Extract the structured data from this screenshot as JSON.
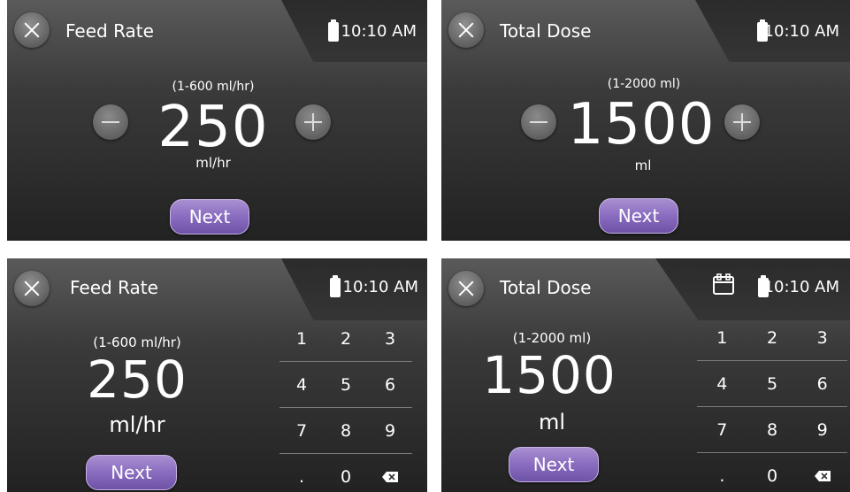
{
  "screens": [
    {
      "title": "Feed Rate",
      "time": "10:10 AM",
      "range": "(1-600 ml/hr)",
      "value": "250",
      "unit": "ml/hr",
      "next_label": "Next"
    },
    {
      "title": "Total Dose",
      "time": "10:10 AM",
      "range": "(1-2000 ml)",
      "value": "1500",
      "unit": "ml",
      "next_label": "Next"
    },
    {
      "title": "Feed Rate",
      "time": "10:10 AM",
      "range": "(1-600 ml/hr)",
      "value": "250",
      "unit": "ml/hr",
      "next_label": "Next",
      "keypad": [
        [
          "1",
          "2",
          "3"
        ],
        [
          "4",
          "5",
          "6"
        ],
        [
          "7",
          "8",
          "9"
        ],
        [
          ".",
          "0",
          ""
        ]
      ]
    },
    {
      "title": "Total Dose",
      "time": "10:10 AM",
      "range": "(1-2000 ml)",
      "value": "1500",
      "unit": "ml",
      "next_label": "Next",
      "keypad": [
        [
          "1",
          "2",
          "3"
        ],
        [
          "4",
          "5",
          "6"
        ],
        [
          "7",
          "8",
          "9"
        ],
        [
          ".",
          "0",
          ""
        ]
      ]
    }
  ],
  "icons": {
    "close": "close-icon",
    "battery": "battery-icon",
    "calendar": "calendar-icon",
    "minus": "minus-icon",
    "plus": "plus-icon",
    "backspace": "backspace-icon"
  },
  "colors": {
    "next_button": "#8a6cc0",
    "screen_background": "#3a3a3a"
  }
}
